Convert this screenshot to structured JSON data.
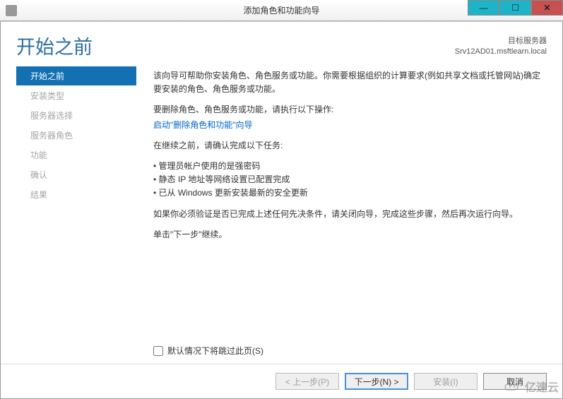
{
  "window": {
    "title": "添加角色和功能向导"
  },
  "header": {
    "page_title": "开始之前",
    "target_label": "目标服务器",
    "target_value": "Srv12AD01.msftlearn.local"
  },
  "sidebar": {
    "items": [
      {
        "label": "开始之前",
        "active": true
      },
      {
        "label": "安装类型",
        "active": false
      },
      {
        "label": "服务器选择",
        "active": false
      },
      {
        "label": "服务器角色",
        "active": false
      },
      {
        "label": "功能",
        "active": false
      },
      {
        "label": "确认",
        "active": false
      },
      {
        "label": "结果",
        "active": false
      }
    ]
  },
  "content": {
    "intro": "该向导可帮助你安装角色、角色服务或功能。你需要根据组织的计算要求(例如共享文档或托管网站)确定要安装的角色、角色服务或功能。",
    "remove_prompt": "要删除角色、角色服务或功能，请执行以下操作:",
    "remove_link": "启动\"删除角色和功能\"向导",
    "verify_prompt": "在继续之前，请确认完成以下任务:",
    "bullets": [
      "管理员帐户使用的是强密码",
      "静态 IP 地址等网络设置已配置完成",
      "已从 Windows 更新安装最新的安全更新"
    ],
    "conditional_note": "如果你必须验证是否已完成上述任何先决条件，请关闭向导，完成这些步骤，然后再次运行向导。",
    "continue_note": "单击\"下一步\"继续。",
    "skip_checkbox_label": "默认情况下将跳过此页(S)"
  },
  "footer": {
    "previous": "< 上一步(P)",
    "next": "下一步(N) >",
    "install": "安装(I)",
    "cancel": "取消"
  },
  "watermark": "亿速云"
}
